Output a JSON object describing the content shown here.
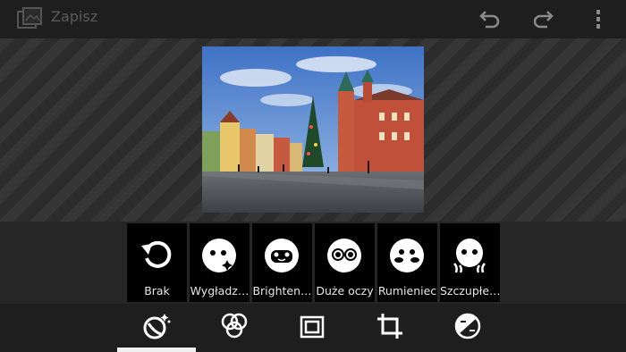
{
  "header": {
    "title": "Zapisz",
    "app_icon": "photo-editor-icon",
    "actions": [
      {
        "name": "undo-icon"
      },
      {
        "name": "redo-icon"
      },
      {
        "name": "overflow-menu-icon"
      }
    ]
  },
  "filters": [
    {
      "label": "Brak",
      "icon": "reset-icon",
      "selected": true
    },
    {
      "label": "Wygładz…",
      "icon": "smooth-face-icon"
    },
    {
      "label": "Brighten…",
      "icon": "brighten-face-icon"
    },
    {
      "label": "Duże oczy",
      "icon": "big-eyes-face-icon"
    },
    {
      "label": "Rumieniec",
      "icon": "blush-face-icon"
    },
    {
      "label": "Szczupłe…",
      "icon": "slim-face-icon"
    }
  ],
  "tools": [
    {
      "name": "face-retouch-tool-icon",
      "active": true
    },
    {
      "name": "color-effects-tool-icon"
    },
    {
      "name": "frame-tool-icon"
    },
    {
      "name": "crop-tool-icon"
    },
    {
      "name": "adjust-tool-icon"
    }
  ],
  "colors": {
    "background": "#1c1c1c",
    "accent": "#f0f0f0"
  }
}
